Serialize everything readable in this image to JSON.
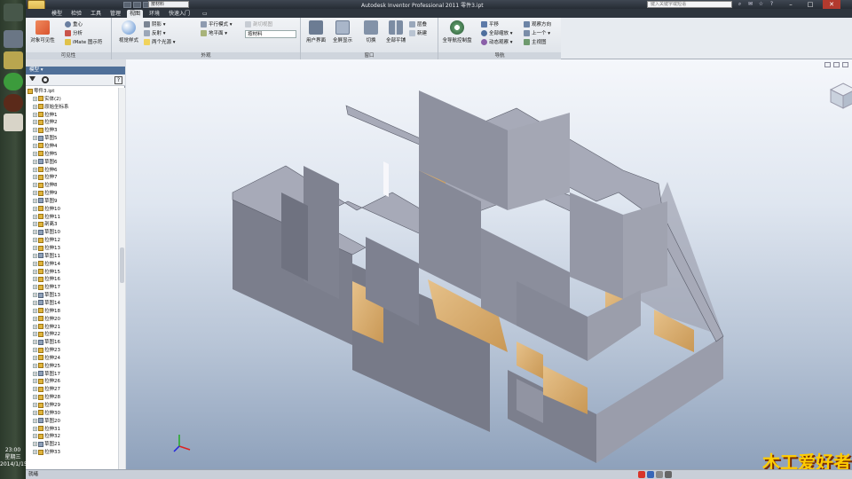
{
  "app": {
    "title": "Autodesk Inventor Professional 2011   零件3.ipt",
    "material": "按材料",
    "search_placeholder": "键入关键字或短语",
    "minimize": "–",
    "maximize": "□",
    "close": "✕"
  },
  "tabs": [
    "模型",
    "检验",
    "工具",
    "管理",
    "视图",
    "环境",
    "快速入门",
    "▭"
  ],
  "ribbon": {
    "visibility": {
      "label": "可见性",
      "object_visibility": "对象可见性",
      "center": "重心",
      "analysis": "分析",
      "imate": "iMate 图示符"
    },
    "appearance": {
      "label": "外观",
      "visual_style": "视觉样式",
      "shadow": "阴影",
      "reflection": "反射",
      "light": "两个光源",
      "parallel": "平行模式",
      "ground": "地平面",
      "section_view": "剖切视图",
      "material": "按材料"
    },
    "window": {
      "label": "窗口",
      "user_interface": "用户界面",
      "fullscreen": "全屏显示",
      "switch": "切换",
      "tile_all": "全部平铺",
      "arrange": "层叠",
      "new": "新建"
    },
    "navigate": {
      "label": "导航",
      "steering_wheel": "全导航控制盘",
      "pan": "平移",
      "zoom_all": "全部缩放",
      "orbit": "动态观察",
      "look_at": "观察方向",
      "previous": "上一个",
      "home": "主视图"
    }
  },
  "browser": {
    "header": "模型 ▾",
    "items": [
      "零件3.ipt",
      "实体(2)",
      "原始坐标系",
      "拉伸1",
      "拉伸2",
      "拉伸3",
      "草图5",
      "拉伸4",
      "拉伸5",
      "草图6",
      "拉伸6",
      "拉伸7",
      "拉伸8",
      "拉伸9",
      "草图9",
      "拉伸10",
      "拉伸11",
      "剖离3",
      "草图10",
      "拉伸12",
      "拉伸13",
      "草图11",
      "拉伸14",
      "拉伸15",
      "拉伸16",
      "拉伸17",
      "草图13",
      "草图14",
      "拉伸18",
      "拉伸20",
      "拉伸21",
      "拉伸22",
      "草图16",
      "拉伸23",
      "拉伸24",
      "拉伸25",
      "草图17",
      "拉伸26",
      "拉伸27",
      "拉伸28",
      "拉伸29",
      "拉伸30",
      "草图20",
      "拉伸31",
      "拉伸32",
      "草图21",
      "拉伸33"
    ]
  },
  "status": {
    "text": "就绪"
  },
  "taskbar": {
    "time": "23:00",
    "weekday": "星期三",
    "date": "2014/1/15"
  },
  "watermark": "木工爱好者"
}
